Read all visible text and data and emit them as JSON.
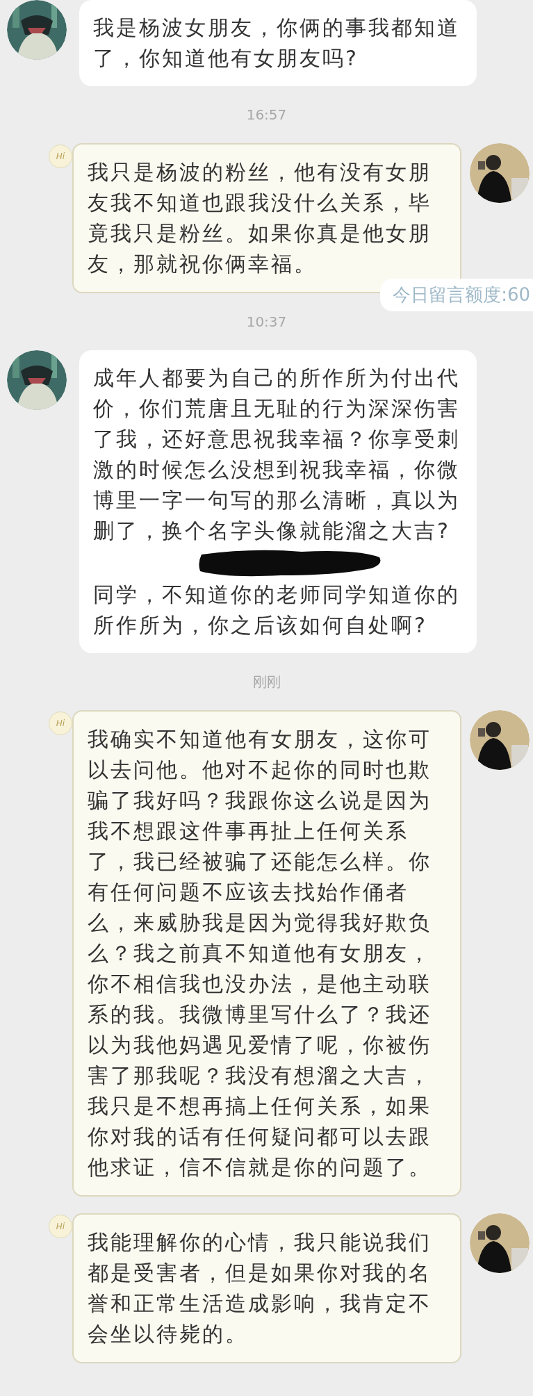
{
  "messages": [
    {
      "kind": "message",
      "outgoing": false,
      "text": "我是杨波女朋友，你俩的事我都知道了，你知道他有女朋友吗?"
    },
    {
      "kind": "time",
      "text": "16:57"
    },
    {
      "kind": "message",
      "outgoing": true,
      "badge": "Hi",
      "text": "我只是杨波的粉丝，他有没有女朋友我不知道也跟我没什么关系，毕竟我只是粉丝。如果你真是他女朋友，那就祝你俩幸福。",
      "note": "今日留言额度:60"
    },
    {
      "kind": "time",
      "text": "10:37"
    },
    {
      "kind": "message",
      "outgoing": false,
      "text": "成年人都要为自己的所作所为付出代价，你们荒唐且无耻的行为深深伤害了我，还好意思祝我幸福？你享受刺激的时候怎么没想到祝我幸福，你微博里一字一句写的那么清晰，真以为删了，换个名字头像就能溜之大吉?",
      "redacted": true,
      "text_after": "同学，不知道你的老师同学知道你的所作所为，你之后该如何自处啊?"
    },
    {
      "kind": "time",
      "text": "刚刚"
    },
    {
      "kind": "message",
      "outgoing": true,
      "badge": "Hi",
      "text": "我确实不知道他有女朋友，这你可以去问他。他对不起你的同时也欺骗了我好吗？我跟你这么说是因为我不想跟这件事再扯上任何关系了，我已经被骗了还能怎么样。你有任何问题不应该去找始作俑者么，来威胁我是因为觉得我好欺负么？我之前真不知道他有女朋友，你不相信我也没办法，是他主动联系的我。我微博里写什么了？我还以为我他妈遇见爱情了呢，你被伤害了那我呢？我没有想溜之大吉，我只是不想再搞上任何关系，如果你对我的话有任何疑问都可以去跟他求证，信不信就是你的问题了。"
    },
    {
      "kind": "message",
      "outgoing": true,
      "badge": "Hi",
      "text": "我能理解你的心情，我只能说我们都是受害者，但是如果你对我的名誉和正常生活造成影响，我肯定不会坐以待毙的。"
    }
  ]
}
